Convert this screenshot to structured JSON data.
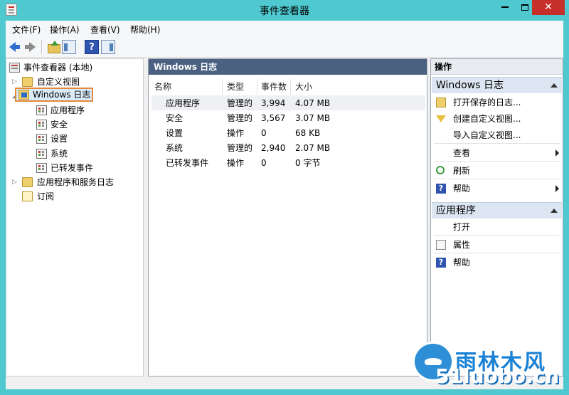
{
  "window": {
    "title": "事件查看器"
  },
  "menu": [
    "文件(F)",
    "操作(A)",
    "查看(V)",
    "帮助(H)"
  ],
  "tree": {
    "root": "事件查看器 (本地)",
    "items": [
      {
        "label": "自定义视图",
        "level": 1,
        "expander": "▷"
      },
      {
        "label": "Windows 日志",
        "level": 1,
        "expander": "◢",
        "selected": true
      },
      {
        "label": "应用程序",
        "level": 2
      },
      {
        "label": "安全",
        "level": 2
      },
      {
        "label": "设置",
        "level": 2
      },
      {
        "label": "系统",
        "level": 2
      },
      {
        "label": "已转发事件",
        "level": 2
      },
      {
        "label": "应用程序和服务日志",
        "level": 1,
        "expander": "▷"
      },
      {
        "label": "订阅",
        "level": 1
      }
    ]
  },
  "middle": {
    "header": "Windows 日志",
    "columns": [
      "名称",
      "类型",
      "事件数",
      "大小"
    ],
    "rows": [
      {
        "name": "应用程序",
        "type": "管理的",
        "count": "3,994",
        "size": "4.07 MB"
      },
      {
        "name": "安全",
        "type": "管理的",
        "count": "3,567",
        "size": "3.07 MB"
      },
      {
        "name": "设置",
        "type": "操作",
        "count": "0",
        "size": "68 KB"
      },
      {
        "name": "系统",
        "type": "管理的",
        "count": "2,940",
        "size": "2.07 MB"
      },
      {
        "name": "已转发事件",
        "type": "操作",
        "count": "0",
        "size": "0 字节"
      }
    ]
  },
  "actions": {
    "header": "操作",
    "section1": {
      "title": "Windows 日志",
      "items": [
        "打开保存的日志...",
        "创建自定义视图...",
        "导入自定义视图...",
        "查看",
        "刷新",
        "帮助"
      ]
    },
    "section2": {
      "title": "应用程序",
      "items": [
        "打开",
        "属性",
        "帮助"
      ]
    }
  },
  "watermark": {
    "title": "雨林木风",
    "url": "51luobo.cn"
  }
}
